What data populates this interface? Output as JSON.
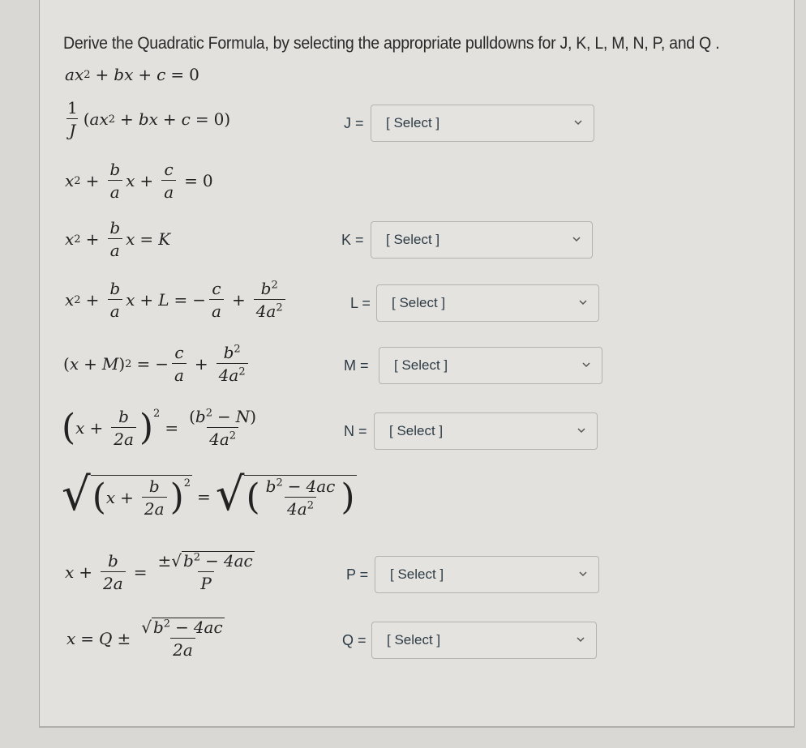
{
  "prompt": "Derive the Quadratic Formula, by selecting the appropriate pulldowns for J, K, L, M, N, P, and Q .",
  "steps": {
    "s0": "ax² + bx + c = 0",
    "s1": "1/J (ax² + bx + c = 0)",
    "s2": "x² + b/a x + c/a = 0",
    "s3": "x² + b/a x = K",
    "s4": "x² + b/a x + L = −c/a + b²/4a²",
    "s5": "(x + M)² = −c/a + b²/4a²",
    "s6": "(x + b/2a)² = (b² − N)/4a²",
    "s7": "√((x + b/2a)²) = √((b² − 4ac)/4a²)",
    "s8": "x + b/2a = ±√(b² − 4ac)/P",
    "s9": "x = Q ± √(b² − 4ac)/2a"
  },
  "math_tokens": {
    "a": "a",
    "b": "b",
    "c": "c",
    "x": "x",
    "zero": "0",
    "one": "1",
    "two": "2",
    "J": "J",
    "K": "K",
    "L": "L",
    "M": "M",
    "N": "N",
    "P": "P",
    "Q": "Q",
    "plus": "+",
    "minus": "−",
    "eq": "=",
    "pm": "±",
    "lparen": "(",
    "rparen": ")",
    "two_a": "2a",
    "four_a": "4a",
    "four_ac": "4ac",
    "b_sq": "b",
    "sq": "2",
    "radical": "√"
  },
  "pulldowns": [
    {
      "var": "J",
      "label": "J =",
      "value": "[ Select ]"
    },
    {
      "var": "K",
      "label": "K =",
      "value": "[ Select ]"
    },
    {
      "var": "L",
      "label": "L =",
      "value": "[ Select ]"
    },
    {
      "var": "M",
      "label": "M =",
      "value": "[ Select ]"
    },
    {
      "var": "N",
      "label": "N =",
      "value": "[ Select ]"
    },
    {
      "var": "P",
      "label": "P =",
      "value": "[ Select ]"
    },
    {
      "var": "Q",
      "label": "Q =",
      "value": "[ Select ]"
    }
  ],
  "icons": {
    "dropdown": "chevron-down-icon"
  }
}
